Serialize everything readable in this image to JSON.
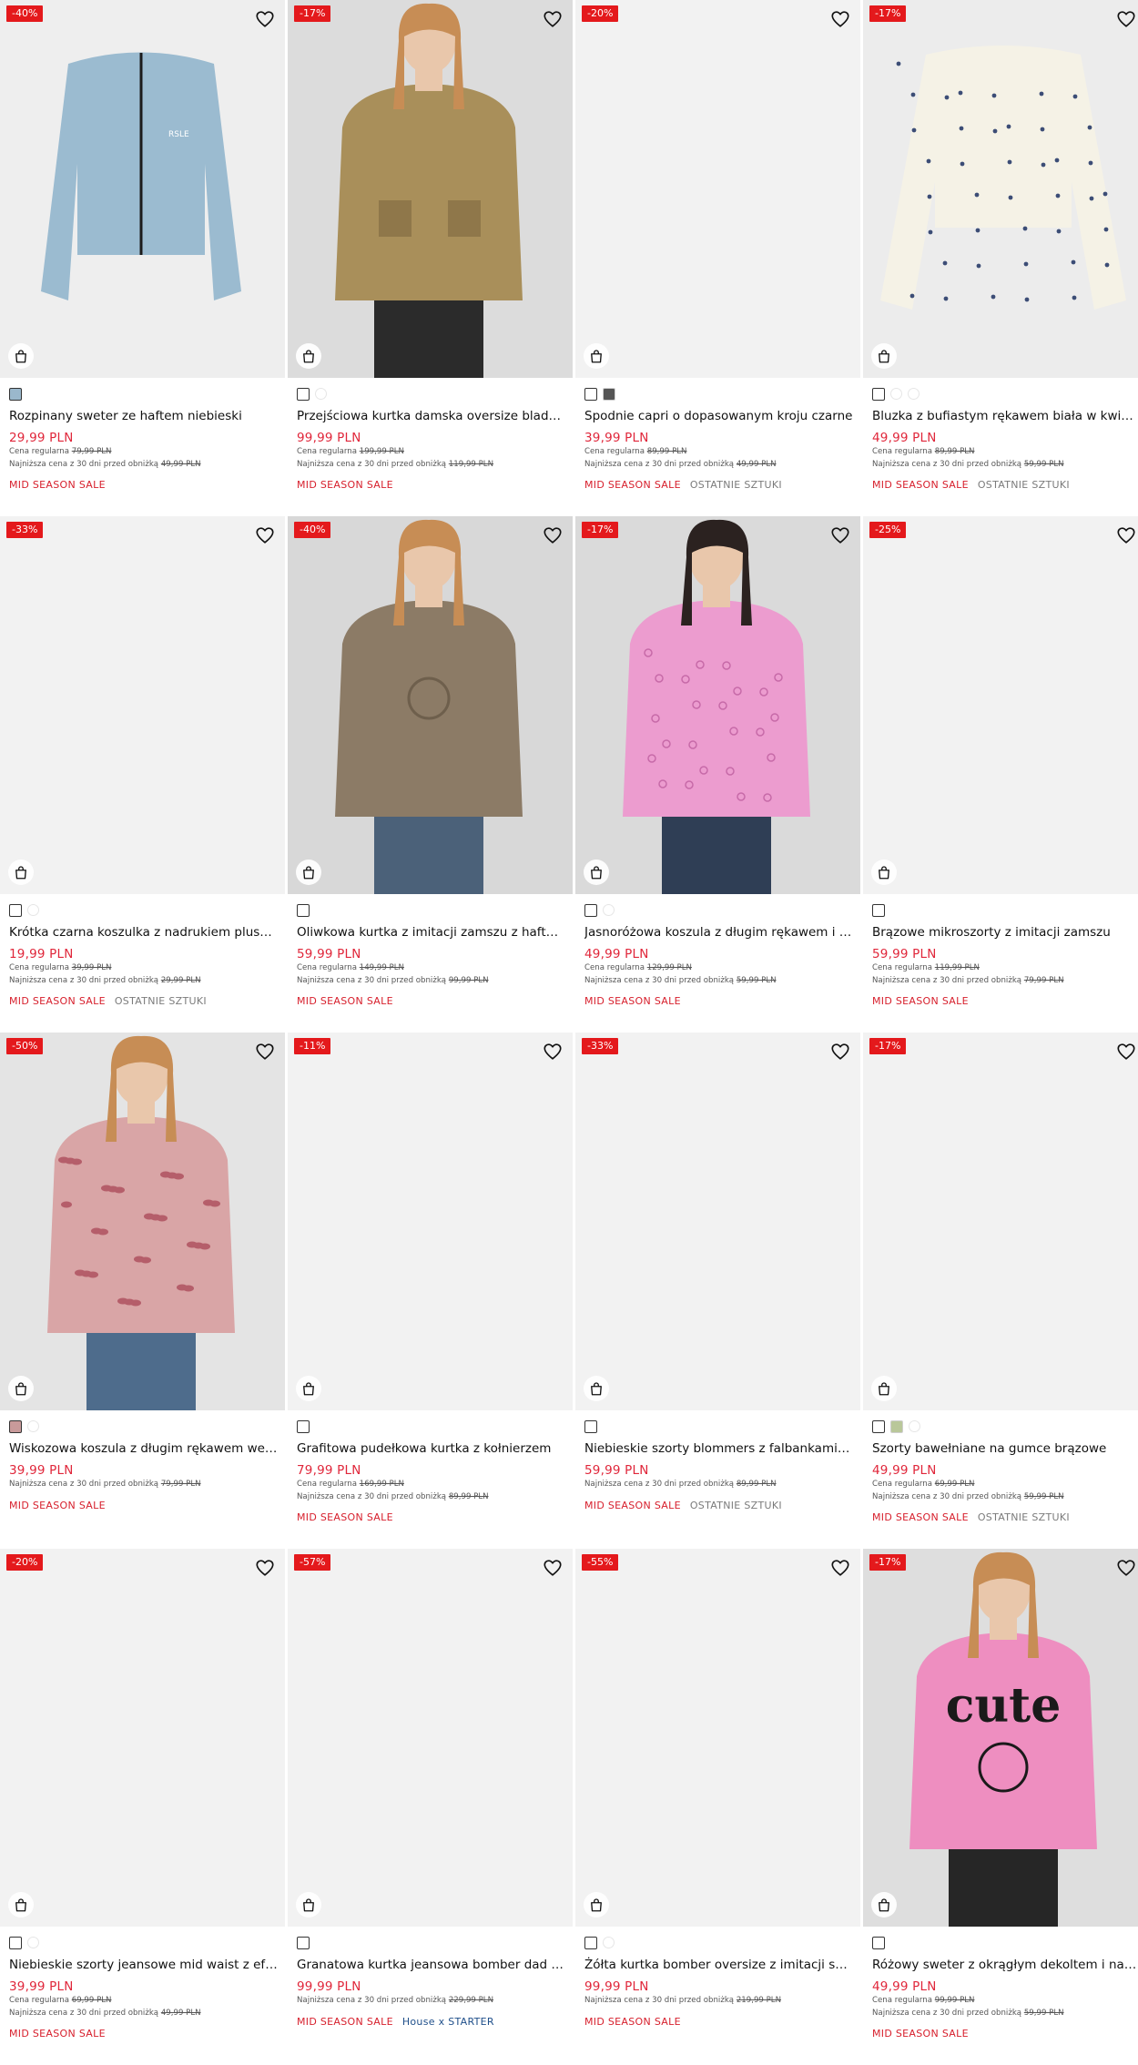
{
  "labels": {
    "regular_prefix": "Cena regularna",
    "lowest_prefix": "Najniższa cena z 30 dni przed obniżką"
  },
  "products": [
    {
      "badge": "-40%",
      "name": "Rozpinany sweter ze haftem niebieski",
      "price": "29,99 PLN",
      "regular": "79,99 PLN",
      "lowest": "49,99 PLN",
      "tags": [
        "MID SEASON SALE"
      ],
      "swatches": [
        "#9ab8cc"
      ],
      "image": "blue-cardigan",
      "bg": "#eeeeee"
    },
    {
      "badge": "-17%",
      "name": "Przejściowa kurtka damska oversize bladozielona",
      "price": "99,99 PLN",
      "regular": "199,99 PLN",
      "lowest": "119,99 PLN",
      "tags": [
        "MID SEASON SALE"
      ],
      "swatches": [
        "#ffffff",
        "ghost"
      ],
      "image": "khaki-jacket-model",
      "bg": "#dcdcdc"
    },
    {
      "badge": "-20%",
      "name": "Spodnie capri o dopasowanym kroju czarne",
      "price": "39,99 PLN",
      "regular": "89,99 PLN",
      "lowest": "49,99 PLN",
      "tags": [
        "MID SEASON SALE",
        "OSTATNIE SZTUKI"
      ],
      "swatches": [
        "#ffffff",
        "#555555"
      ],
      "image": "",
      "bg": "#f2f2f2"
    },
    {
      "badge": "-17%",
      "name": "Bluzka z bufiastym rękawem biała w kwiatki",
      "price": "49,99 PLN",
      "regular": "89,99 PLN",
      "lowest": "59,99 PLN",
      "tags": [
        "MID SEASON SALE",
        "OSTATNIE SZTUKI"
      ],
      "swatches": [
        "#ffffff",
        "ghost",
        "ghost"
      ],
      "image": "floral-blouse",
      "bg": "#ececec"
    },
    {
      "badge": "-33%",
      "name": "Krótka czarna koszulka z nadrukiem pluszowego misia",
      "price": "19,99 PLN",
      "regular": "39,99 PLN",
      "lowest": "29,99 PLN",
      "tags": [
        "MID SEASON SALE",
        "OSTATNIE SZTUKI"
      ],
      "swatches": [
        "#ffffff",
        "ghost"
      ],
      "image": "",
      "bg": "#f2f2f2"
    },
    {
      "badge": "-40%",
      "name": "Oliwkowa kurtka z imitacji zamszu z haftem",
      "price": "59,99 PLN",
      "regular": "149,99 PLN",
      "lowest": "99,99 PLN",
      "tags": [
        "MID SEASON SALE"
      ],
      "swatches": [
        "#ffffff"
      ],
      "image": "suede-jacket-model",
      "bg": "#d8d8d8"
    },
    {
      "badge": "-17%",
      "name": "Jasnoróżowa koszula z długim rękawem i haftem angielskim",
      "price": "49,99 PLN",
      "regular": "129,99 PLN",
      "lowest": "59,99 PLN",
      "tags": [
        "MID SEASON SALE"
      ],
      "swatches": [
        "#ffffff",
        "ghost"
      ],
      "image": "pink-shirt-model",
      "bg": "#dadada"
    },
    {
      "badge": "-25%",
      "name": "Brązowe mikroszorty z imitacji zamszu",
      "price": "59,99 PLN",
      "regular": "119,99 PLN",
      "lowest": "79,99 PLN",
      "tags": [
        "MID SEASON SALE"
      ],
      "swatches": [
        "#ffffff"
      ],
      "image": "",
      "bg": "#f2f2f2"
    },
    {
      "badge": "-50%",
      "name": "Wiskozowa koszula z długim rękawem we wzór paisley",
      "price": "39,99 PLN",
      "regular": "",
      "lowest": "79,99 PLN",
      "tags": [
        "MID SEASON SALE"
      ],
      "swatches": [
        "#c89a9a",
        "ghost"
      ],
      "image": "paisley-shirt-model",
      "bg": "#e4e4e4"
    },
    {
      "badge": "-11%",
      "name": "Grafitowa pudełkowa kurtka z kołnierzem",
      "price": "79,99 PLN",
      "regular": "169,99 PLN",
      "lowest": "89,99 PLN",
      "tags": [
        "MID SEASON SALE"
      ],
      "swatches": [
        "#ffffff"
      ],
      "image": "",
      "bg": "#f2f2f2"
    },
    {
      "badge": "-33%",
      "name": "Niebieskie szorty blommers z falbankami w kwiaty",
      "price": "59,99 PLN",
      "regular": "",
      "lowest": "89,99 PLN",
      "tags": [
        "MID SEASON SALE",
        "OSTATNIE SZTUKI"
      ],
      "swatches": [
        "#ffffff"
      ],
      "image": "",
      "bg": "#f2f2f2"
    },
    {
      "badge": "-17%",
      "name": "Szorty bawełniane na gumce brązowe",
      "price": "49,99 PLN",
      "regular": "69,99 PLN",
      "lowest": "59,99 PLN",
      "tags": [
        "MID SEASON SALE",
        "OSTATNIE SZTUKI"
      ],
      "swatches": [
        "#ffffff",
        "#b9c79a",
        "ghost"
      ],
      "image": "",
      "bg": "#f2f2f2"
    },
    {
      "badge": "-20%",
      "name": "Niebieskie szorty jeansowe mid waist z efektem sprania",
      "price": "39,99 PLN",
      "regular": "69,99 PLN",
      "lowest": "49,99 PLN",
      "tags": [
        "MID SEASON SALE"
      ],
      "swatches": [
        "#ffffff",
        "ghost"
      ],
      "image": "",
      "bg": "#f2f2f2"
    },
    {
      "badge": "-57%",
      "name": "Granatowa kurtka jeansowa bomber dad fit House x STARTER",
      "price": "99,99 PLN",
      "regular": "",
      "lowest": "229,99 PLN",
      "tags": [
        "MID SEASON SALE",
        "House x STARTER"
      ],
      "swatches": [
        "#ffffff"
      ],
      "image": "",
      "bg": "#f2f2f2"
    },
    {
      "badge": "-55%",
      "name": "Żółta kurtka bomber oversize z imitacji skóry",
      "price": "99,99 PLN",
      "regular": "",
      "lowest": "219,99 PLN",
      "tags": [
        "MID SEASON SALE"
      ],
      "swatches": [
        "#ffffff",
        "ghost"
      ],
      "image": "",
      "bg": "#f2f2f2"
    },
    {
      "badge": "-17%",
      "name": "Różowy sweter z okrągłym dekoltem i napisem cute",
      "price": "49,99 PLN",
      "regular": "99,99 PLN",
      "lowest": "59,99 PLN",
      "tags": [
        "MID SEASON SALE"
      ],
      "swatches": [
        "#ffffff"
      ],
      "image": "pink-cute-sweater-model",
      "bg": "#dedede",
      "print_text": "cute"
    }
  ]
}
